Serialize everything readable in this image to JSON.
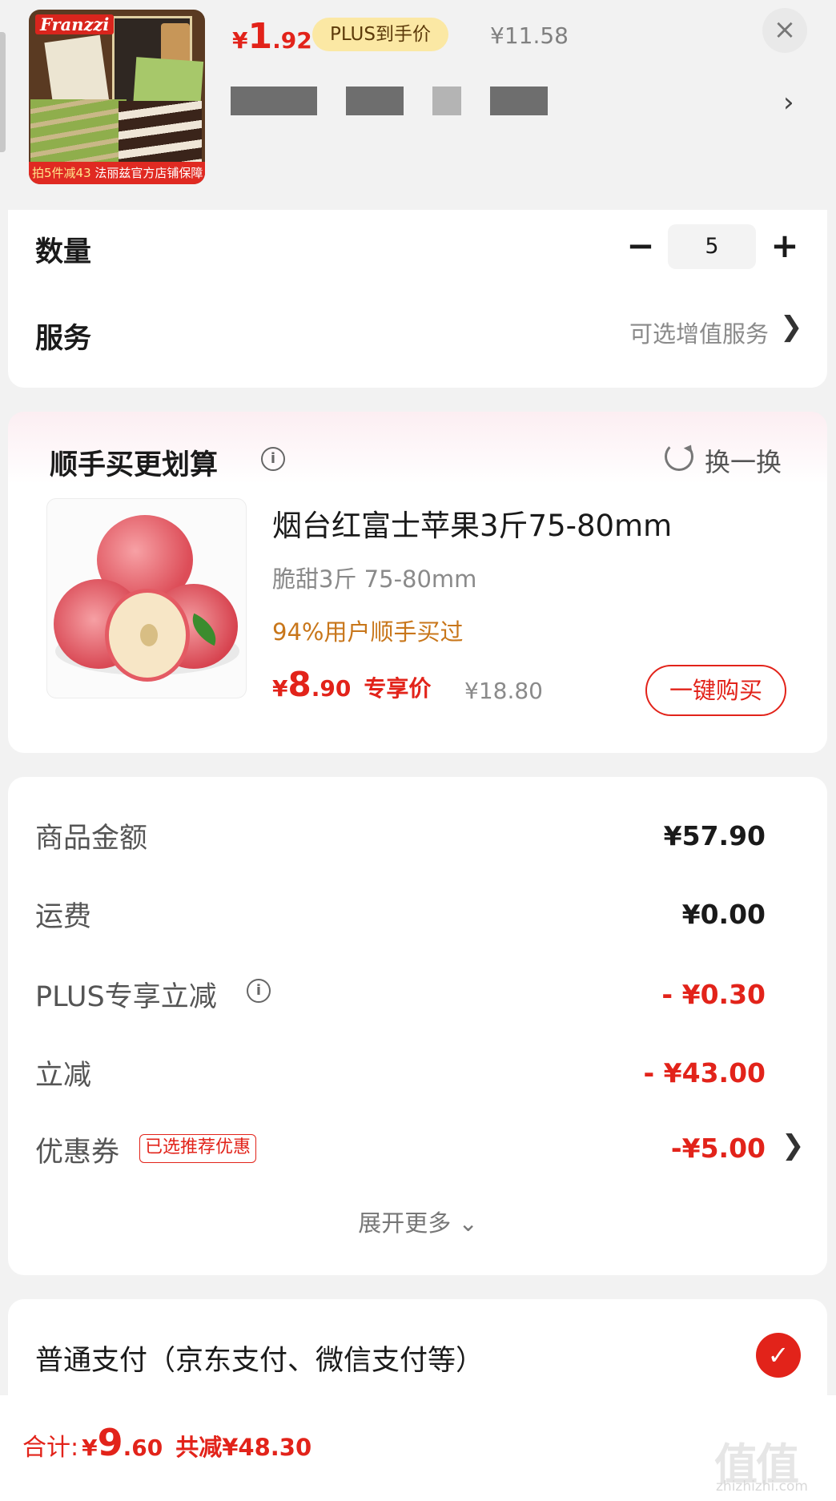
{
  "header": {
    "thumbnail": {
      "brand": "Franzzi",
      "promo_left": "拍5件减43",
      "promo_right": "法丽兹官方店铺保障"
    },
    "price": {
      "currency": "¥",
      "integer": "1",
      "decimal": ".92"
    },
    "plus_badge": "PLUS到手价",
    "original_price": "¥11.58",
    "close_icon": "close-icon",
    "chevron_icon": "chevron-right-icon"
  },
  "quantity": {
    "label": "数量",
    "value": "5",
    "minus": "−",
    "plus": "+"
  },
  "service": {
    "label": "服务",
    "value": "可选增值服务",
    "chevron": "❯"
  },
  "addon": {
    "title": "顺手买更划算",
    "swap_label": "换一换",
    "product": {
      "name": "烟台红富士苹果3斤75-80mm",
      "spec": "脆甜3斤 75-80mm",
      "social_proof": "94%用户顺手买过",
      "price": {
        "currency": "¥",
        "integer": "8",
        "decimal": ".90"
      },
      "price_tag": "专享价",
      "original_price": "¥18.80",
      "buy_button": "一键购买"
    }
  },
  "amounts": {
    "items": [
      {
        "label": "商品金额",
        "value": "¥57.90"
      },
      {
        "label": "运费",
        "value": "¥0.00"
      },
      {
        "label": "PLUS专享立减",
        "value": "- ¥0.30"
      },
      {
        "label": "立减",
        "value": "- ¥43.00"
      },
      {
        "label": "优惠券",
        "value": "-¥5.00"
      }
    ],
    "coupon_badge": "已选推荐优惠",
    "expand_more": "展开更多 ⌄"
  },
  "payment": {
    "label": "普通支付（京东支付、微信支付等）",
    "check": "✓"
  },
  "bottom": {
    "total_label": "合计:",
    "total": {
      "currency": "¥",
      "integer": "9",
      "decimal": ".60"
    },
    "saved": "共减¥48.30"
  },
  "watermark": {
    "logo": "值值值",
    "url": "zhizhizhi.com"
  },
  "colors": {
    "accent": "#e2231a",
    "plus_badge_bg": "#fbe8a4",
    "social_proof": "#c8761a"
  }
}
